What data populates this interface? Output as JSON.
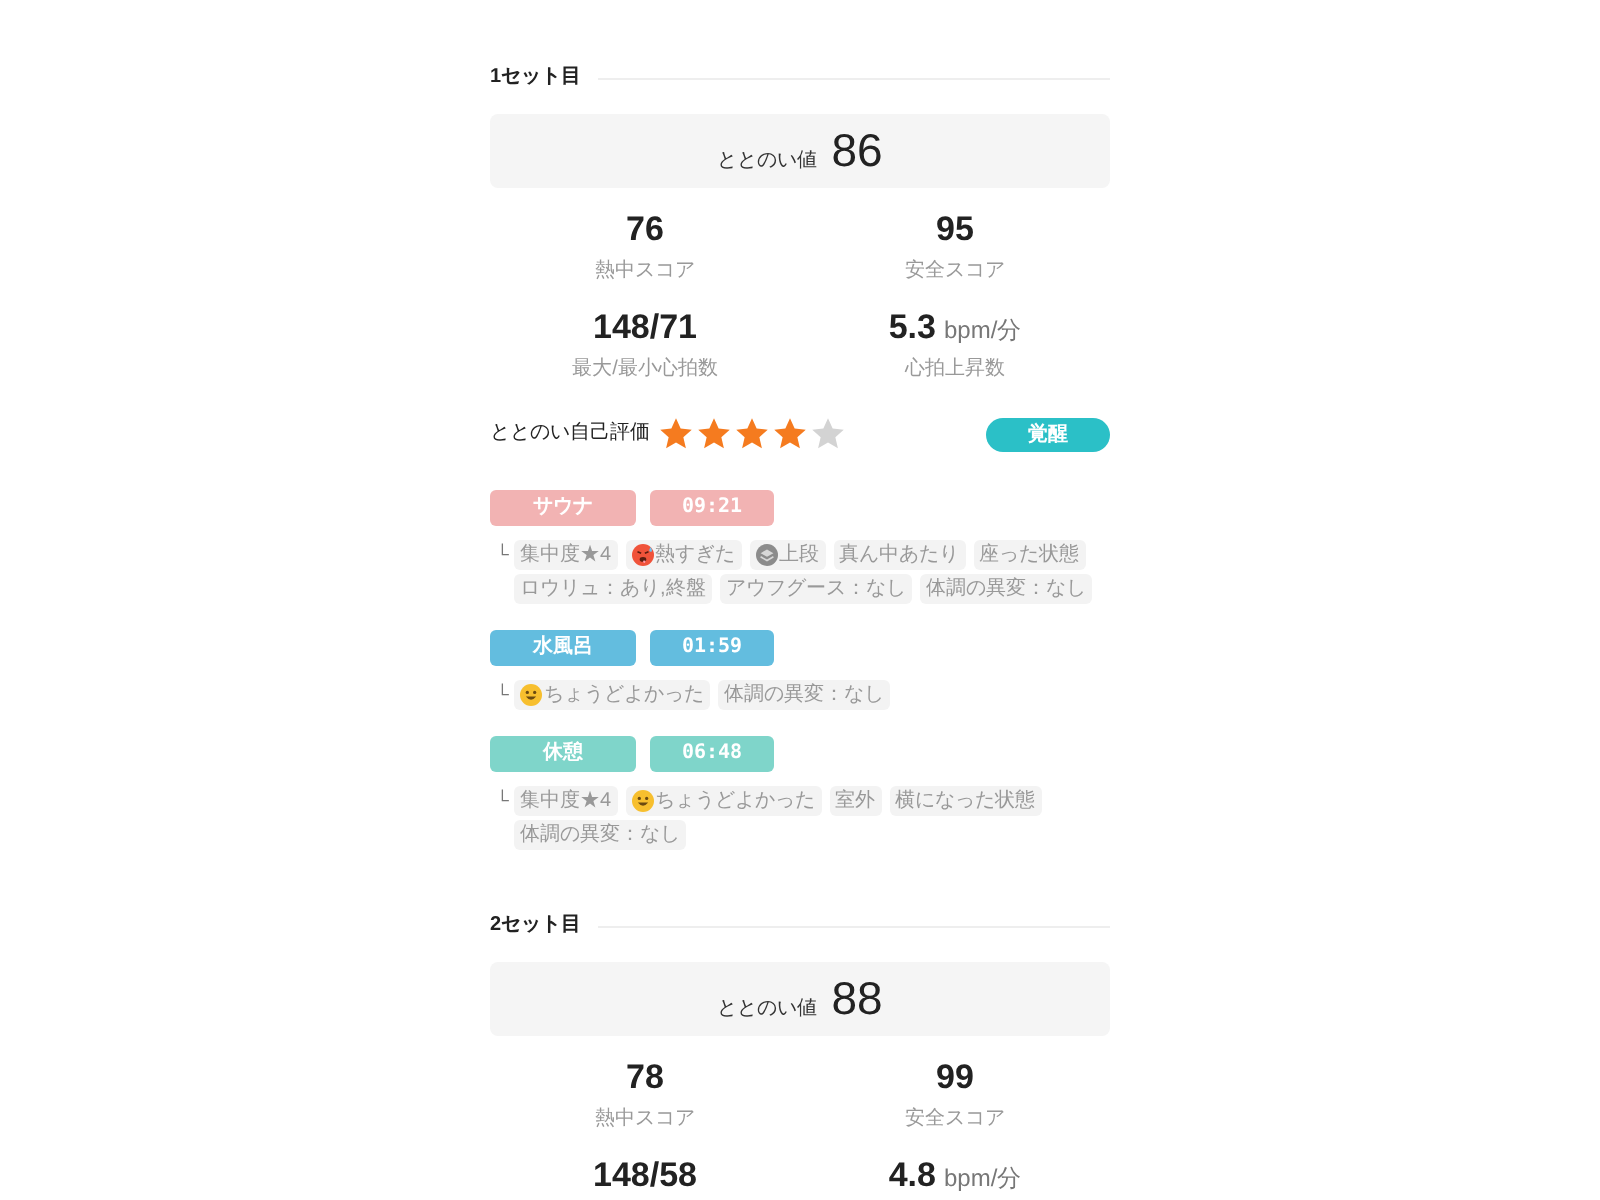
{
  "sets": [
    {
      "title": "1セット目",
      "totonoi": {
        "label": "ととのい値",
        "value": "86"
      },
      "scores": [
        {
          "value": "76",
          "label": "熱中スコア"
        },
        {
          "value": "95",
          "label": "安全スコア"
        },
        {
          "value": "148/71",
          "label": "最大/最小心拍数"
        },
        {
          "value": "5.3",
          "unit": "bpm/分",
          "label": "心拍上昇数"
        }
      ],
      "rating": {
        "label": "ととのい自己評価",
        "stars": 4,
        "badge": "覚醒"
      },
      "phases": [
        {
          "name": "サウナ",
          "time": "09:21",
          "color": "#f2b3b3",
          "marker": "└",
          "tags": [
            {
              "kind": "plain",
              "text": "集中度★4"
            },
            {
              "kind": "hot",
              "text": "熱すぎた"
            },
            {
              "kind": "layers",
              "text": "上段"
            },
            {
              "kind": "plain",
              "text": "真ん中あたり"
            },
            {
              "kind": "plain",
              "text": "座った状態"
            },
            {
              "kind": "plain",
              "text": "ロウリュ：あり,終盤"
            },
            {
              "kind": "plain",
              "text": "アウフグース：なし"
            },
            {
              "kind": "plain",
              "text": "体調の異変：なし"
            }
          ]
        },
        {
          "name": "水風呂",
          "time": "01:59",
          "color": "#63bddf",
          "marker": "└",
          "tags": [
            {
              "kind": "smile",
              "text": "ちょうどよかった"
            },
            {
              "kind": "plain",
              "text": "体調の異変：なし"
            }
          ]
        },
        {
          "name": "休憩",
          "time": "06:48",
          "color": "#7fd5ca",
          "marker": "└",
          "tags": [
            {
              "kind": "plain",
              "text": "集中度★4"
            },
            {
              "kind": "smile",
              "text": "ちょうどよかった"
            },
            {
              "kind": "plain",
              "text": "室外"
            },
            {
              "kind": "plain",
              "text": "横になった状態"
            },
            {
              "kind": "plain",
              "text": "体調の異変：なし"
            }
          ]
        }
      ]
    },
    {
      "title": "2セット目",
      "totonoi": {
        "label": "ととのい値",
        "value": "88"
      },
      "scores": [
        {
          "value": "78",
          "label": "熱中スコア"
        },
        {
          "value": "99",
          "label": "安全スコア"
        },
        {
          "value": "148/58"
        },
        {
          "value": "4.8",
          "unit": "bpm/分"
        }
      ]
    }
  ]
}
